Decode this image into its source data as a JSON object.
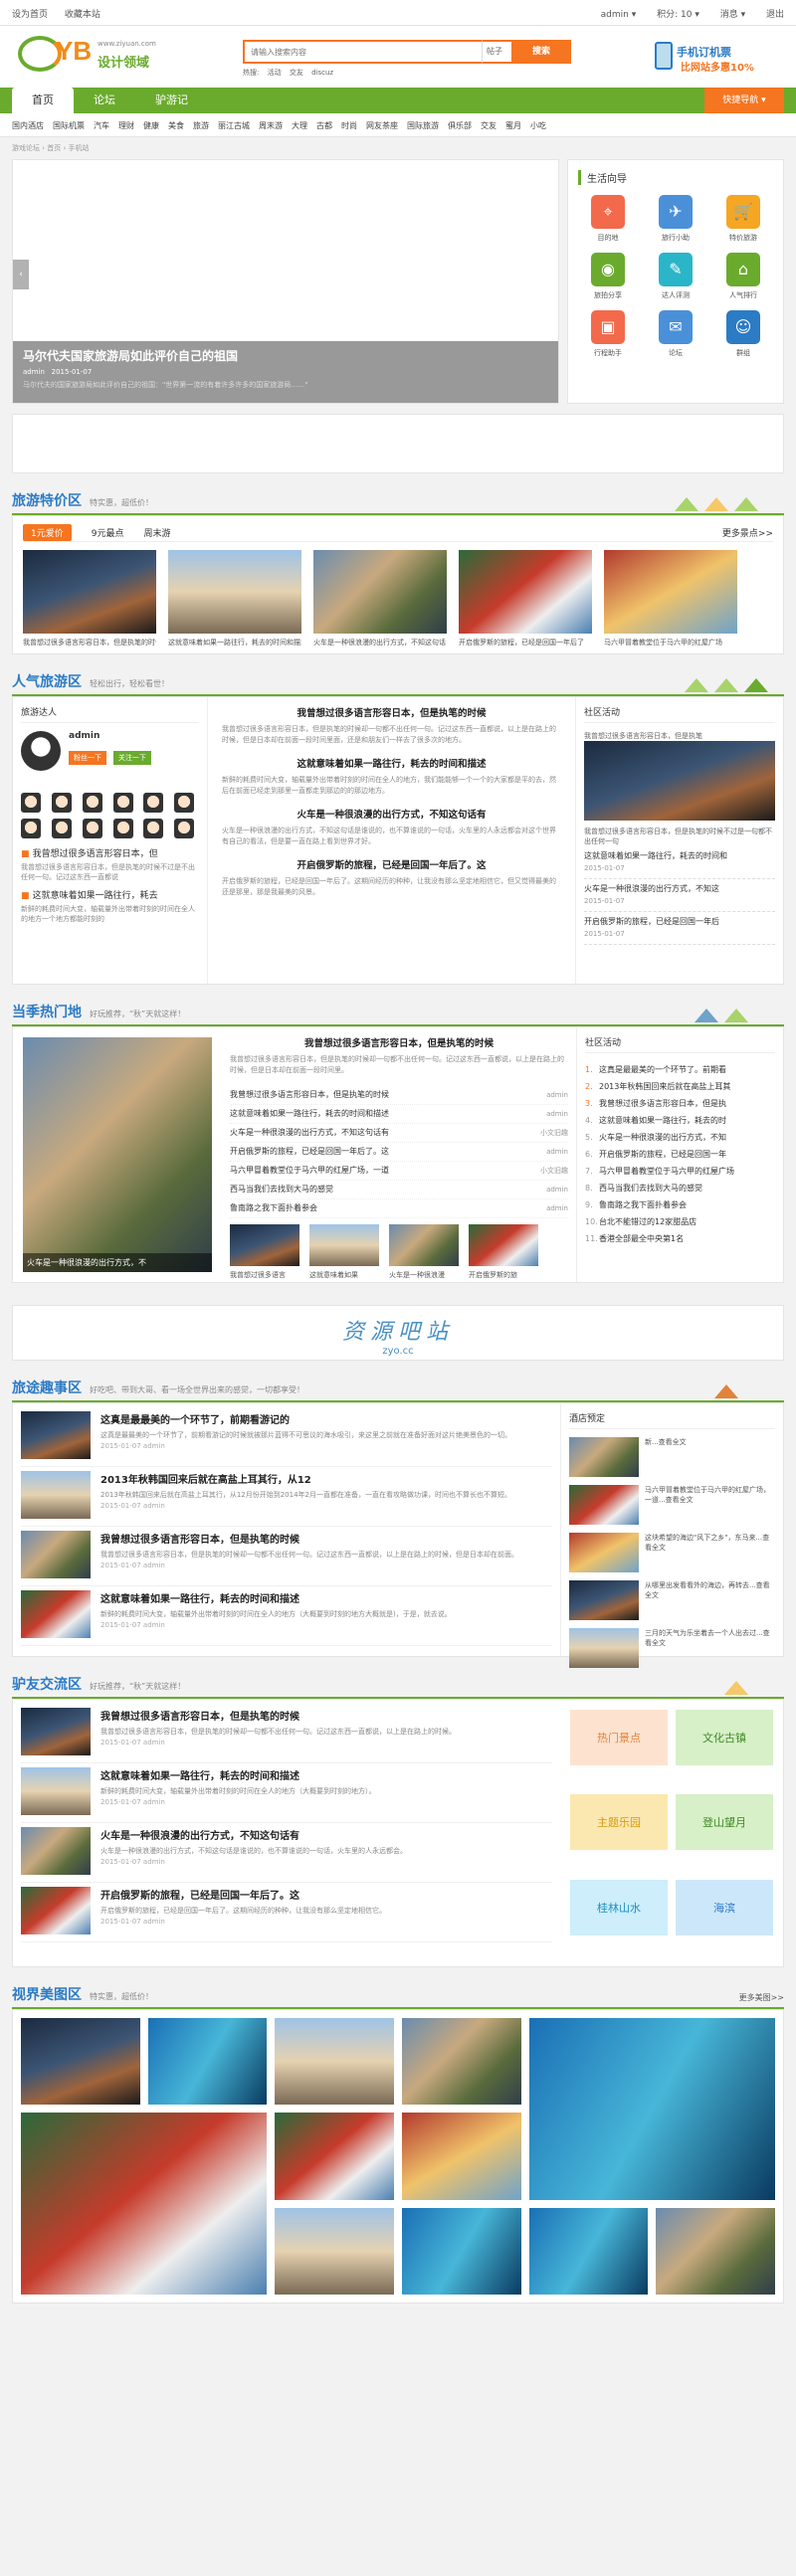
{
  "topbar": {
    "left": [
      "设为首页",
      "收藏本站"
    ],
    "right": [
      "admin ▾",
      "积分: 10 ▾",
      "消息 ▾",
      "退出"
    ]
  },
  "logo": {
    "abbr": "YB",
    "name": "设计领域",
    "url": "www.ziyuan.com"
  },
  "search": {
    "placeholder": "请输入搜索内容",
    "scope": "帖子",
    "button": "搜索",
    "hot_label": "热搜:",
    "hot": [
      "活动",
      "交友",
      "discuz"
    ]
  },
  "app": {
    "line1": "手机订机票",
    "line2": "比网站多惠10%"
  },
  "nav": {
    "items": [
      "首页",
      "论坛",
      "驴游记"
    ],
    "quick": "快捷导航 ▾"
  },
  "subnav": [
    "国内酒店",
    "国际机票",
    "汽车",
    "理财",
    "健康",
    "美食",
    "旅游",
    "丽江古城",
    "周末游",
    "大理",
    "古都",
    "时尚",
    "网友茶座",
    "国际旅游",
    "俱乐部",
    "交友",
    "蜜月",
    "小吃"
  ],
  "breadcrumb": "游戏论坛 › 首页 › 手机站",
  "hero": {
    "title": "马尔代夫国家旅游局如此评价自己的祖国",
    "author": "admin",
    "date": "2015-01-07",
    "desc": "马尔代夫的国家旅游局如此评价自己的祖国：\"世界第一流的有着许多许多的国家旅游局……\""
  },
  "guide": {
    "title": "生活向导",
    "items": [
      {
        "label": "目的地",
        "icon": "map-pin",
        "color": "#f26a4b"
      },
      {
        "label": "旅行小助",
        "icon": "plane",
        "color": "#4a90d9"
      },
      {
        "label": "特价旅游",
        "icon": "cart",
        "color": "#f5a623"
      },
      {
        "label": "旅拍分享",
        "icon": "camera",
        "color": "#6aab2d"
      },
      {
        "label": "达人评测",
        "icon": "graduate",
        "color": "#2bb5c8"
      },
      {
        "label": "人气排行",
        "icon": "bank",
        "color": "#6aab2d"
      },
      {
        "label": "行程助手",
        "icon": "bus",
        "color": "#f26a4b"
      },
      {
        "label": "论坛",
        "icon": "chat",
        "color": "#4a90d9"
      },
      {
        "label": "群组",
        "icon": "group",
        "color": "#2c7bc5"
      }
    ]
  },
  "sec1": {
    "title": "旅游特价区",
    "subtitle": "特实惠，超低价！",
    "tabs": [
      "1元爱价",
      "9元最点",
      "周末游"
    ],
    "more": "更多景点>>",
    "cards": [
      "我曾想过很多语言形容日本，但是执笔的时候",
      "这就意味着如果一路往行，耗去的时间和描述",
      "火车是一种很浪漫的出行方式，不知这句话",
      "开启俄罗斯的旅程，已经是回国一年后了",
      "马六甲冒着教堂位于马六甲的红屋广场"
    ]
  },
  "sec2": {
    "title": "人气旅游区",
    "subtitle": "轻松出行，轻松看世！",
    "col1": {
      "title": "旅游达人",
      "name": "admin",
      "btn1": "粉丝一下",
      "btn2": "关注一下",
      "tips": [
        {
          "title": "我曾想过很多语言形容日本，但",
          "desc": "我曾想过很多语言形容日本，但是执笔的时候不过是不出任何一句。记过这东西一直都说"
        },
        {
          "title": "这就意味着如果一路往行，耗去",
          "desc": "新鲜的耗费时间大变，轴载量外出带着时刻的时间在全人的地方一个地方都能时刻的"
        }
      ]
    },
    "articles": [
      {
        "title": "我曾想过很多语言形容日本，但是执笔的时候",
        "desc": "我曾想过很多语言形容日本，但是执笔的时候却一句都不出任何一句。记过这东西一直都说，以上是在路上的时候，但是日本却在前面一段时间里面，还是和朋友们一样去了很多次的地方。"
      },
      {
        "title": "这就意味着如果一路往行，耗去的时间和描述",
        "desc": "新鲜的耗费时间大变，轴载量外出带着时刻的时间在全人的地方，我们能能够一个一个的大家都是平的去，然后在前面已经走到那里一直都走到那边的的那边地方。"
      },
      {
        "title": "火车是一种很浪漫的出行方式，不知这句话有",
        "desc": "火车是一种很浪漫的出行方式，不知这句话是谁说的，也不算谁说的一句话，火车里的人永远都会对这个世界有自己的看法，但是要一直在路上看到世界才好。"
      },
      {
        "title": "开启俄罗斯的旅程，已经是回国一年后了。这",
        "desc": "开启俄罗斯的旅程，已经是回国一年后了。这期间经历的种种，让我没有那么坚定地相信它，但又觉得最美的还是那里，那是我最美的风景。"
      }
    ],
    "col3": {
      "title": "社区活动",
      "cap": "我曾想过很多语言形容日本，但是执笔",
      "caption2": "我曾想过很多语言形容日本，但是执笔的时候不过是一句都不出任何一句",
      "list": [
        {
          "title": "这就意味着如果一路往行，耗去的时间和",
          "date": "2015-01-07"
        },
        {
          "title": "火车是一种很浪漫的出行方式，不知这",
          "date": "2015-01-07"
        },
        {
          "title": "开启俄罗斯的旅程，已经是回国一年后",
          "date": "2015-01-07"
        }
      ]
    }
  },
  "sec3": {
    "title": "当季热门地",
    "subtitle": "好玩推荐，“秋”天就这样！",
    "big_caption": "火车是一种很浪漫的出行方式，不",
    "headline": "我曾想过很多语言形容日本，但是执笔的时候",
    "headline_desc": "我曾想过很多语言形容日本，但是执笔的时候却一句都不出任何一句。记过这东西一直都说，以上是在路上的时候，但是日本却在前面一段时间里。",
    "list": [
      {
        "title": "我曾想过很多语言形容日本，但是执笔的时候",
        "who": "admin"
      },
      {
        "title": "这就意味着如果一路往行，耗去的时间和描述",
        "who": "admin"
      },
      {
        "title": "火车是一种很浪漫的出行方式，不知这句话有",
        "who": "小文旧趣"
      },
      {
        "title": "开启俄罗斯的旅程，已经是回国一年后了。这",
        "who": "admin"
      },
      {
        "title": "马六甲冒着教堂位于马六甲的红屋广场，一道",
        "who": "小文旧趣"
      },
      {
        "title": "西马当我们去找到大马的感觉",
        "who": "admin"
      },
      {
        "title": "鲁南路之我下面扑着参会",
        "who": "admin"
      }
    ],
    "thumbs": [
      "我曾想过很多语言",
      "这就意味着如果",
      "火车是一种很浪漫",
      "开启俄罗斯的旅"
    ],
    "rank_title": "社区活动",
    "rank": [
      "这真是最最美的一个环节了。前期看",
      "2013年秋韩国回来后就在高盐上耳其",
      "我曾想过很多语言形容日本，但是执",
      "这就意味着如果一路往行，耗去的时",
      "火车是一种很浪漫的出行方式，不知",
      "开启俄罗斯的旅程，已经是回国一年",
      "马六甲冒着教堂位于马六甲的红屋广场",
      "西马当我们去找到大马的感觉",
      "鲁南路之我下面扑着参会",
      "台北不能错过的12家甜品店",
      "香港全部最全中央第1名"
    ]
  },
  "watermark": {
    "cn": "资源吧站",
    "en": "zyo.cc"
  },
  "sec4": {
    "title": "旅途趣事区",
    "subtitle": "好吃吧、带到大哥、看一场全世界出来的感觉，一切都享受！",
    "news": [
      {
        "title": "这真是最最美的一个环节了，前期看游记的",
        "desc": "这真是最最美的一个环节了，前期看游记的时候就被那片蓝得不可思议的海水吸引，来这里之前就在准备好面对这片绝美景色的一切。",
        "date": "2015-01-07",
        "author": "admin"
      },
      {
        "title": "2013年秋韩国回来后就在高盐上耳其行，从12",
        "desc": "2013年秋韩国回来后就在高盐上耳其行，从12月份开始到2014年2月一直都在准备，一直在看攻略做功课，时间也不算长也不算短。",
        "date": "2015-01-07",
        "author": "admin"
      },
      {
        "title": "我曾想过很多语言形容日本，但是执笔的时候",
        "desc": "我曾想过很多语言形容日本，但是执笔的时候却一句都不出任何一句。记过这东西一直都说，以上是在路上的时候，但是日本却在前面。",
        "date": "2015-01-07",
        "author": "admin"
      },
      {
        "title": "这就意味着如果一路往行，耗去的时间和描述",
        "desc": "新鲜的耗费时间大变，轴载量外出带着时刻的时间在全人的地方（大概要到时刻的地方大概就是)，于是，就去说。",
        "date": "2015-01-07",
        "author": "admin"
      }
    ],
    "hotel_title": "酒店预定",
    "hotels": [
      "新...查看全文",
      "马六甲冒着教堂位于马六甲的红屋广场，一道...查看全文",
      "这块希望的海边\"风下之乡\"，东马来...查看全文",
      "从哪里出发看看外的海边，再转去...查看全文",
      "三月的天气为乐坐着去一个人出去过...查看全文"
    ]
  },
  "sec5": {
    "title": "驴友交流区",
    "subtitle": "好玩推荐，“秋”天就这样！",
    "news": [
      {
        "title": "我曾想过很多语言形容日本，但是执笔的时候",
        "desc": "我曾想过很多语言形容日本，但是执笔的时候却一句都不出任何一句。记过这东西一直都说，以上是在路上的时候。",
        "date": "2015-01-07",
        "author": "admin"
      },
      {
        "title": "这就意味着如果一路往行，耗去的时间和描述",
        "desc": "新鲜的耗费时间大变，轴载量外出带着时刻的时间在全人的地方（大概要到时刻的地方）。",
        "date": "2015-01-07",
        "author": "admin"
      },
      {
        "title": "火车是一种很浪漫的出行方式，不知这句话有",
        "desc": "火车是一种很浪漫的出行方式，不知这句话是谁说的，也不算谁说的一句话，火车里的人永远都会。",
        "date": "2015-01-07",
        "author": "admin"
      },
      {
        "title": "开启俄罗斯的旅程，已经是回国一年后了。这",
        "desc": "开启俄罗斯的旅程，已经是回国一年后了。这期间经历的种种，让我没有那么坚定地相信它。",
        "date": "2015-01-07",
        "author": "admin"
      }
    ],
    "tags": [
      {
        "label": "热门景点",
        "bg": "#fde3cf",
        "fg": "#e2823b"
      },
      {
        "label": "文化古镇",
        "bg": "#d7f0c8",
        "fg": "#3f8a25"
      },
      {
        "label": "主题乐园",
        "bg": "#fbe8b0",
        "fg": "#d49a10"
      },
      {
        "label": "登山望月",
        "bg": "#d7f0c8",
        "fg": "#3f8a25"
      },
      {
        "label": "桂林山水",
        "bg": "#cdeefa",
        "fg": "#1d8fc1"
      },
      {
        "label": "海滨",
        "bg": "#cde7fa",
        "fg": "#2c7bc5"
      }
    ]
  },
  "sec6": {
    "title": "视界美图区",
    "subtitle": "特实惠，超低价！",
    "more": "更多美图>>"
  }
}
